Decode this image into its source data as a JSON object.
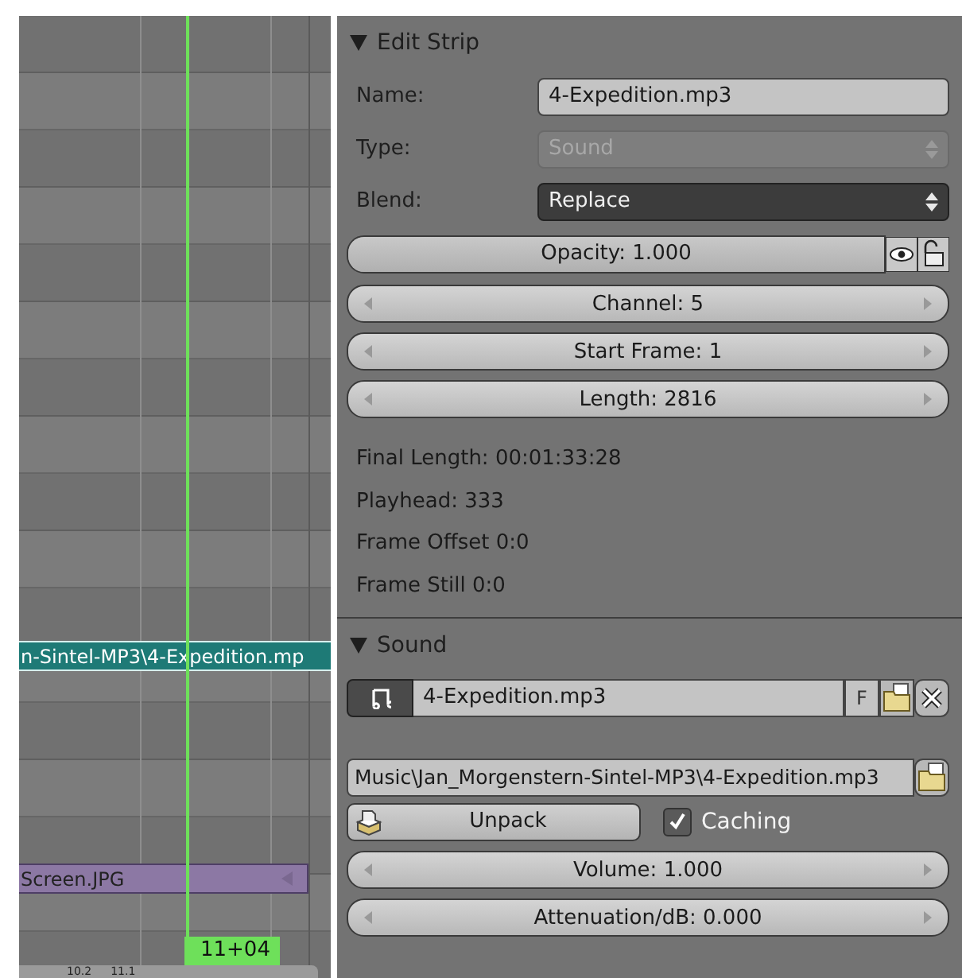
{
  "timeline": {
    "strips": [
      {
        "kind": "sound",
        "label": "n-Sintel-MP3\\4-Expedition.mp"
      },
      {
        "kind": "image",
        "label": "Screen.JPG"
      }
    ],
    "playhead": {
      "label": "11+04"
    },
    "ruler": [
      "10.2",
      "11.1"
    ]
  },
  "edit_strip": {
    "title": "Edit Strip",
    "expanded": true,
    "fields": [
      {
        "kind": "text",
        "label": "Name:",
        "value": "4-Expedition.mp3",
        "disabled": false
      },
      {
        "kind": "dropdown",
        "label": "Type:",
        "value": "Sound",
        "disabled": true
      },
      {
        "kind": "dropdown",
        "label": "Blend:",
        "value": "Replace",
        "disabled": false
      }
    ],
    "opacity": {
      "label": "Opacity: 1.000",
      "level": 1
    },
    "numbers": [
      "Channel: 5",
      "Start Frame: 1",
      "Length: 2816"
    ],
    "info": [
      "Final Length: 00:01:33:28",
      "Playhead: 333",
      "Frame Offset 0:0",
      "Frame Still 0:0"
    ]
  },
  "sound": {
    "title": "Sound",
    "expanded": true,
    "datablock": "4-Expedition.mp3",
    "fake_user": "F",
    "filepath": "Music\\Jan_Morgenstern-Sintel-MP3\\4-Expedition.mp3",
    "unpack": "Unpack",
    "caching": {
      "label": "Caching",
      "checked": true
    },
    "numbers": [
      "Volume: 1.000",
      "Attenuation/dB: 0.000"
    ]
  }
}
